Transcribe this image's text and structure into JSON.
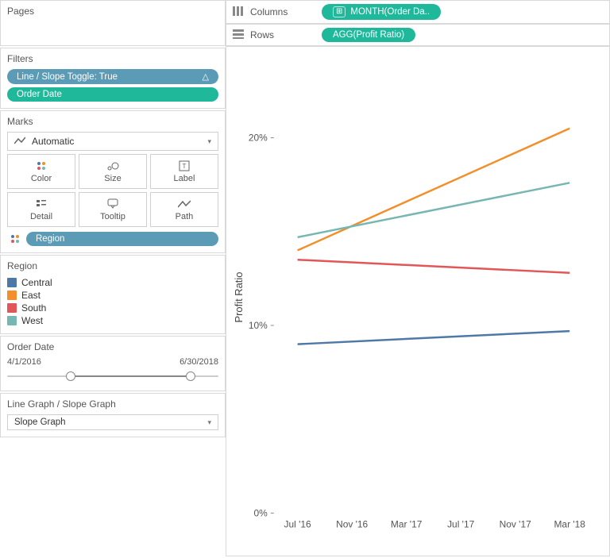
{
  "left": {
    "pages": "Pages",
    "filters": {
      "title": "Filters",
      "items": [
        {
          "label": "Line / Slope Toggle: True",
          "style": "blue",
          "delta": "△"
        },
        {
          "label": "Order Date",
          "style": "teal",
          "delta": ""
        }
      ]
    },
    "marks": {
      "title": "Marks",
      "selector": "Automatic",
      "buttons": [
        "Color",
        "Size",
        "Label",
        "Detail",
        "Tooltip",
        "Path"
      ],
      "assigned": "Region"
    },
    "legend": {
      "title": "Region",
      "items": [
        {
          "label": "Central",
          "color": "#4e79a7"
        },
        {
          "label": "East",
          "color": "#f28e2b"
        },
        {
          "label": "South",
          "color": "#e15759"
        },
        {
          "label": "West",
          "color": "#76b7b2"
        }
      ]
    },
    "date": {
      "title": "Order Date",
      "from": "4/1/2016",
      "to": "6/30/2018",
      "low_pct": 30,
      "high_pct": 87
    },
    "param": {
      "title": "Line Graph / Slope Graph",
      "value": "Slope Graph"
    }
  },
  "shelves": {
    "columns": {
      "label": "Columns",
      "pill": "MONTH(Order Da..",
      "plus": true
    },
    "rows": {
      "label": "Rows",
      "pill": "AGG(Profit Ratio)",
      "plus": false
    }
  },
  "chart_data": {
    "type": "line",
    "title": "",
    "ylabel": "Profit Ratio",
    "xlabel": "",
    "yticks": [
      0,
      10,
      20
    ],
    "yticks_fmt": [
      "0%",
      "10%",
      "20%"
    ],
    "ylim": [
      0,
      23
    ],
    "x_tick_labels": [
      "Jul '16",
      "Nov '16",
      "Mar '17",
      "Jul '17",
      "Nov '17",
      "Mar '18"
    ],
    "series": [
      {
        "name": "Central",
        "color": "#4e79a7",
        "y": [
          9.0,
          9.7
        ]
      },
      {
        "name": "East",
        "color": "#f28e2b",
        "y": [
          14.0,
          20.5
        ]
      },
      {
        "name": "South",
        "color": "#e15759",
        "y": [
          13.5,
          12.8
        ]
      },
      {
        "name": "West",
        "color": "#76b7b2",
        "y": [
          14.7,
          17.6
        ]
      }
    ],
    "x_endpoints": [
      "Apr '16",
      "Jun '18"
    ]
  }
}
